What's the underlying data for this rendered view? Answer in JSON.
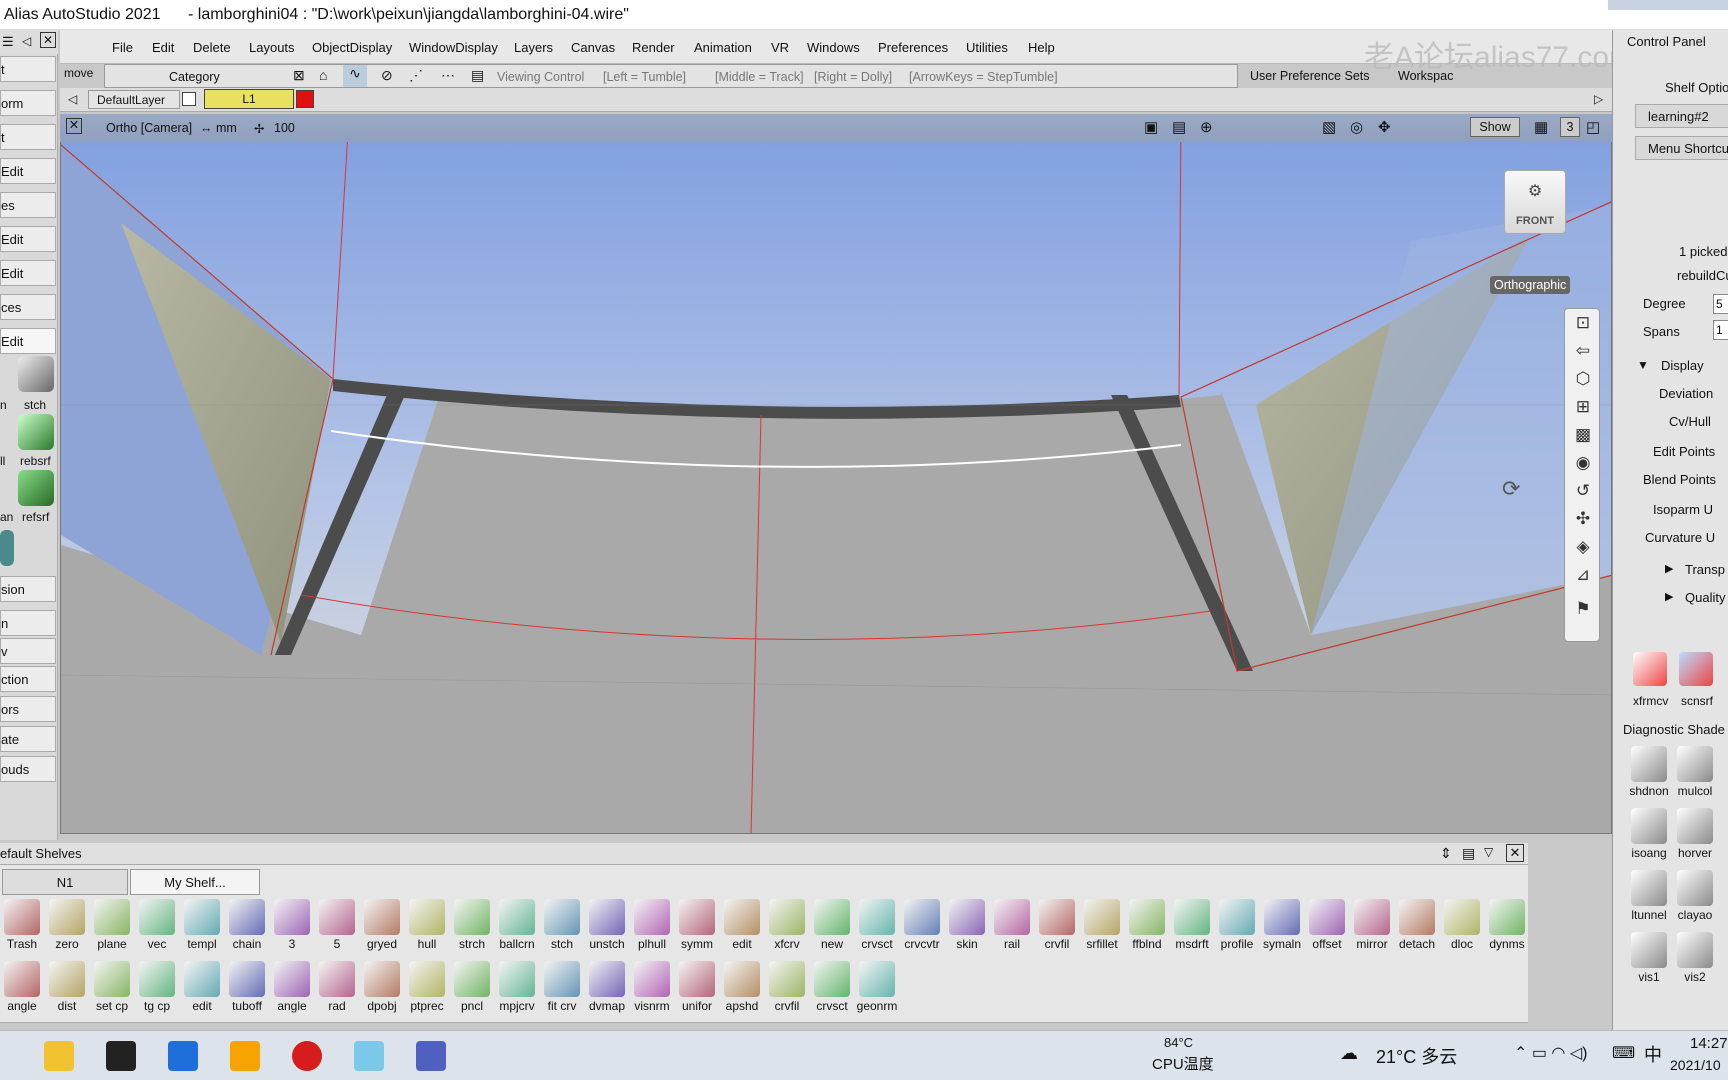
{
  "window": {
    "title": "Alias AutoStudio 2021",
    "file": "- lamborghini04 : \"D:\\work\\peixun\\jiangda\\lamborghini-04.wire\""
  },
  "menu": [
    "File",
    "Edit",
    "Delete",
    "Layouts",
    "ObjectDisplay",
    "WindowDisplay",
    "Layers",
    "Canvas",
    "Render",
    "Animation",
    "VR",
    "Windows",
    "Preferences",
    "Utilities",
    "Help"
  ],
  "move_label": "move",
  "control_bar": {
    "category": "Category",
    "viewing_control": "Viewing Control",
    "left": "[Left = Tumble]",
    "middle": "[Middle = Track]",
    "right": "[Right = Dolly]",
    "arrows": "[ArrowKeys = StepTumble]",
    "user_pref": "User Preference Sets",
    "workspace": "Workspac"
  },
  "watermark": "老A论坛alias77.com",
  "layers": {
    "default": "DefaultLayer",
    "active": "L1"
  },
  "viewport": {
    "camera": "Ortho [Camera]",
    "units": "↔ mm",
    "grid": "100",
    "show_btn": "Show",
    "num": "3",
    "cube_label": "FRONT",
    "ortho_label": "Orthographic"
  },
  "left_palette": {
    "buttons": [
      "t",
      "orm",
      "t",
      "Edit",
      "es",
      "Edit",
      "Edit",
      "ces",
      "Edit",
      "sion",
      "n",
      "v",
      "ction",
      "ors",
      "ate",
      "ouds"
    ],
    "icons": [
      "stch",
      "rebsrf",
      "refsrf"
    ],
    "side_labels": [
      "n",
      "ll",
      "an",
      "l"
    ]
  },
  "shelf": {
    "title": "efault Shelves",
    "tabs": [
      "N1",
      "My Shelf..."
    ],
    "row1": [
      "Trash",
      "zero",
      "plane",
      "vec",
      "templ",
      "chain",
      "3",
      "5",
      "gryed",
      "hull",
      "strch",
      "ballcrn",
      "stch",
      "unstch",
      "plhull",
      "symm",
      "edit",
      "xfcrv",
      "new",
      "crvsct",
      "crvcvtr",
      "skin",
      "rail",
      "crvfil",
      "srfillet",
      "ffblnd",
      "msdrft",
      "profile",
      "symaln",
      "offset",
      "mirror",
      "detach",
      "dloc",
      "dynms"
    ],
    "row2": [
      "angle",
      "dist",
      "set cp",
      "tg cp",
      "edit",
      "tuboff",
      "angle",
      "rad",
      "dpobj",
      "ptprec",
      "pncl",
      "mpjcrv",
      "fit crv",
      "dvmap",
      "visnrm",
      "unifor",
      "apshd",
      "crvfil",
      "crvsct",
      "geonrm"
    ]
  },
  "right_panel": {
    "control_panel": "Control Panel",
    "shelf_options": "Shelf Options",
    "learning": "learning#2",
    "menu_shortcut": "Menu Shortcu",
    "picked": "1 picked",
    "rebuild": "rebuildCu",
    "degree_label": "Degree",
    "degree_val": "5",
    "spans_label": "Spans",
    "spans_val": "1",
    "display": "Display",
    "deviation": "Deviation",
    "cvhull": "Cv/Hull",
    "editpoints": "Edit Points",
    "blendpoints": "Blend Points",
    "isoparm": "Isoparm U",
    "curvature": "Curvature U",
    "transp": "Transp",
    "quality": "Quality",
    "tools_top": [
      "xfrmcv",
      "scnsrf"
    ],
    "diag": "Diagnostic Shade",
    "diag_tools": [
      "shdnon",
      "mulcol",
      "isoang",
      "horver",
      "ltunnel",
      "clayao",
      "vis1",
      "vis2"
    ]
  },
  "taskbar": {
    "temp_cpu": "84°C",
    "cpu_label": "CPU温度",
    "weather": "21°C 多云",
    "ime": "中",
    "time": "14:27",
    "date": "2021/10"
  },
  "colors": {
    "accent_yellow": "#e8e060",
    "layer_red": "#e01010",
    "sky_top": "#7f9ee0",
    "floor": "#a9a9a9",
    "wedge": "#a8aa94"
  }
}
